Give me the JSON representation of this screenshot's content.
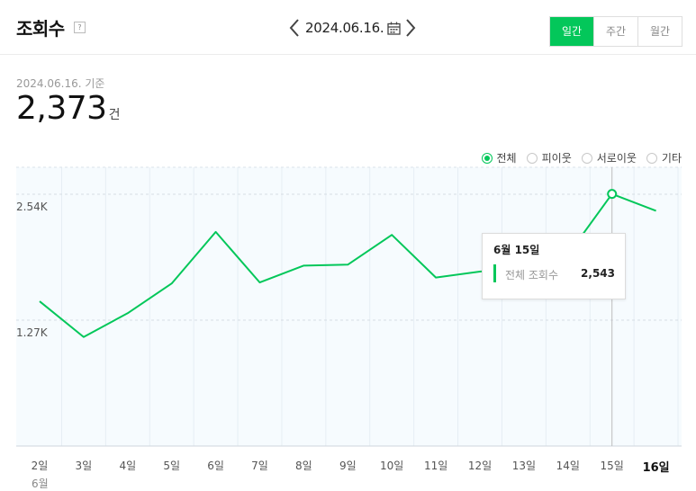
{
  "header": {
    "title": "조회수",
    "help_icon": "?",
    "date": "2024.06.16.",
    "period_tabs": [
      {
        "label": "일간",
        "active": true
      },
      {
        "label": "주간",
        "active": false
      },
      {
        "label": "월간",
        "active": false
      }
    ]
  },
  "summary": {
    "basis": "2024.06.16. 기준",
    "total": "2,373",
    "unit": "건"
  },
  "legend": [
    {
      "label": "전체",
      "selected": true
    },
    {
      "label": "피이웃",
      "selected": false
    },
    {
      "label": "서로이웃",
      "selected": false
    },
    {
      "label": "기타",
      "selected": false
    }
  ],
  "tooltip": {
    "title": "6월 15일",
    "label": "전체 조회수",
    "value": "2,543"
  },
  "colors": {
    "accent": "#03c75a",
    "plot_bg": "#f6fbfe"
  },
  "chart_data": {
    "type": "line",
    "categories": [
      "2일",
      "3일",
      "4일",
      "5일",
      "6일",
      "7일",
      "8일",
      "9일",
      "10일",
      "11일",
      "12일",
      "13일",
      "14일",
      "15일",
      "16일"
    ],
    "month_label": "6월",
    "series": [
      {
        "name": "전체",
        "values": [
          1460,
          1100,
          1340,
          1640,
          2160,
          1650,
          1820,
          1830,
          2130,
          1700,
          1760,
          1800,
          1930,
          2543,
          2373
        ]
      }
    ],
    "yticks": [
      {
        "value": 1270,
        "label": "1.27K"
      },
      {
        "value": 2540,
        "label": "2.54K"
      }
    ],
    "ylim": [
      0,
      2540
    ],
    "highlight_index": 13,
    "highlight_category": "15일",
    "bold_category": "16일"
  }
}
